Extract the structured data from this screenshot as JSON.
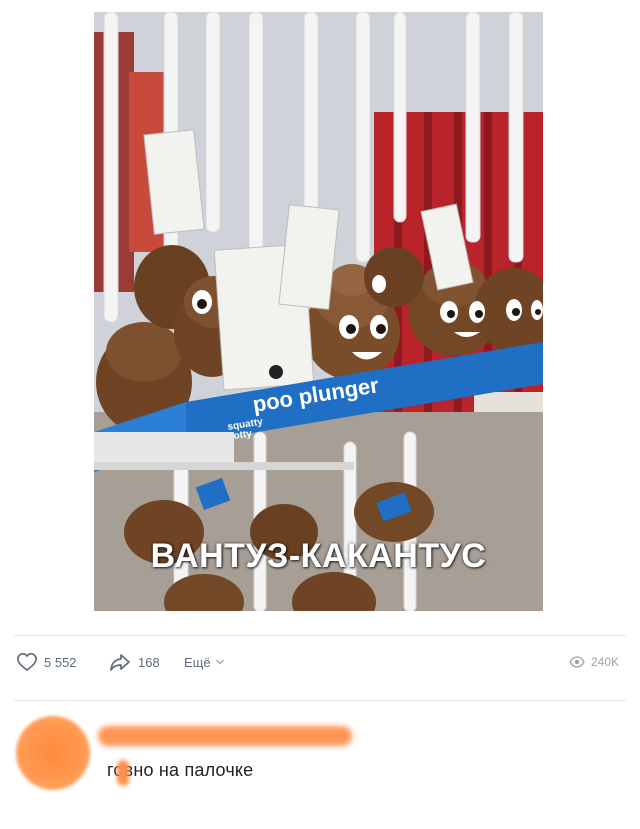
{
  "post": {
    "image_caption": "ВАНТУЗ-КАКАНТУС",
    "product_box_text": "poo plunger",
    "product_brand": "squatty potty"
  },
  "actions": {
    "likes": "5 552",
    "shares": "168",
    "more_label": "Ещё",
    "views": "240K"
  },
  "comment": {
    "text": "говно на палочке"
  },
  "colors": {
    "accent_blurred": "#ff8f4a",
    "icon": "#5f6b79",
    "muted": "#99a2ad"
  }
}
